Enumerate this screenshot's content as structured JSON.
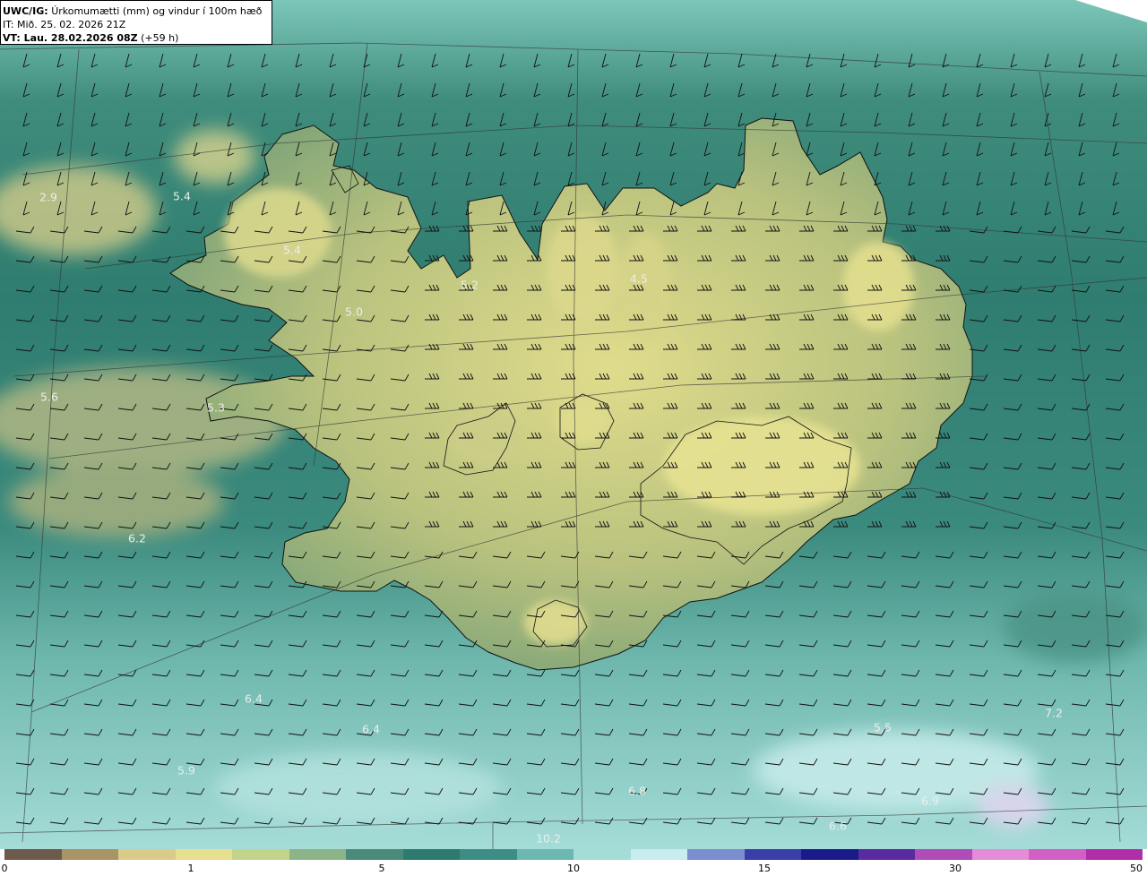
{
  "header": {
    "model": "UWC/IG:",
    "title": "Úrkomumætti (mm) og vindur í 100m hæð",
    "init_time": "IT: Mið. 25. 02. 2026 21Z",
    "valid_label": "VT: Lau. 28.02.2026 08Z",
    "lead_time": "(+59 h)"
  },
  "map_labels": [
    "2.9",
    "5.4",
    "5.2",
    "5.0",
    "5.6",
    "6.2",
    "6.4",
    "5.9",
    "6.8",
    "10.2",
    "6.6",
    "6.9",
    "7.2",
    "6.4",
    "4.5",
    "5.3",
    "5.4",
    "5.5"
  ],
  "colorbar": {
    "ticks": [
      "0",
      "1",
      "5",
      "10",
      "15",
      "30",
      "50"
    ],
    "colors": [
      "#6e5a4a",
      "#a89464",
      "#d8cc88",
      "#e6e090",
      "#c2d48c",
      "#8cb488",
      "#4a8a78",
      "#2e7a6e",
      "#3c8e84",
      "#6cb8b0",
      "#a4dcd6",
      "#c8ecf0",
      "#7a8ed0",
      "#3a3ea8",
      "#1a1a8a",
      "#5a2aa0",
      "#b04cb8",
      "#e48cd8",
      "#d060c4",
      "#b02ea8"
    ]
  },
  "colors": {
    "ocean": "#2f7d70",
    "land": "#b7c07e",
    "land_bright": "#e0dc8c",
    "south_sea": "#8fd0c8"
  }
}
